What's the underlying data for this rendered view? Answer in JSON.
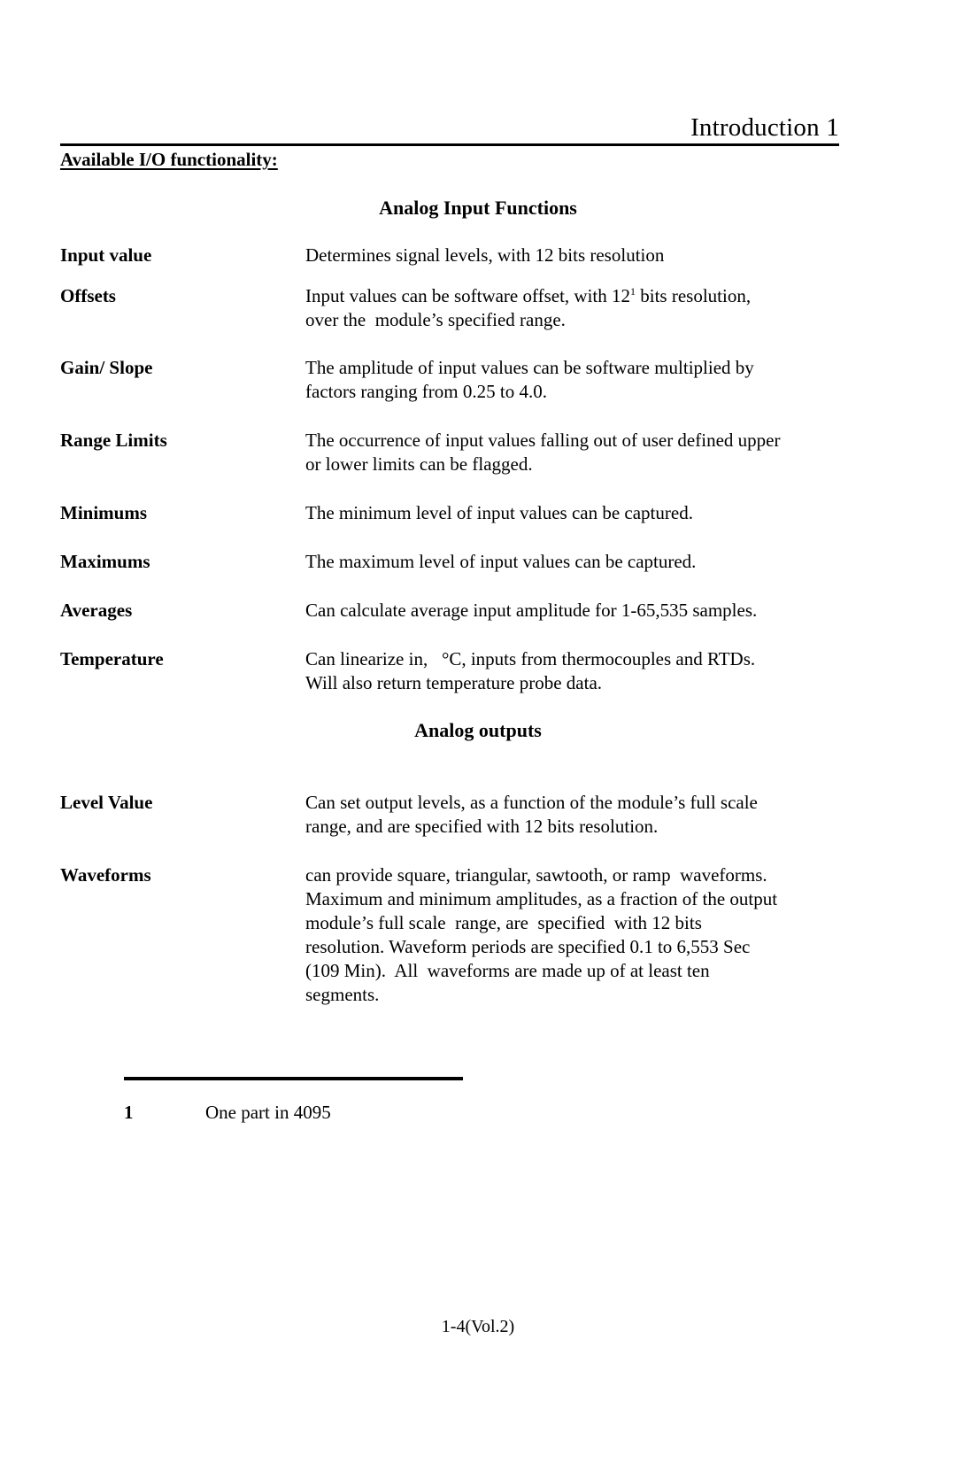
{
  "header": {
    "title": "Introduction 1"
  },
  "section": {
    "heading": "Available I/O functionality:"
  },
  "groups": {
    "analog_input_heading": "Analog Input Functions",
    "analog_output_heading": "Analog outputs"
  },
  "analog_input_rows": [
    {
      "term": "Input value",
      "lines": [
        "Determines signal levels, with 12 bits resolution"
      ]
    },
    {
      "term": "Offsets",
      "lines": [
        "Input values can be software offset, with 12",
        " bits resolution,",
        "over the  module’s specified range."
      ],
      "footnote_marker": "1"
    },
    {
      "term": "Gain/ Slope",
      "lines": [
        "The amplitude of input values can be software multiplied by",
        "factors ranging from 0.25 to 4.0."
      ]
    },
    {
      "term": "Range Limits",
      "lines": [
        "The occurrence of input values falling out of user defined upper",
        "or lower limits can be flagged."
      ]
    },
    {
      "term": "Minimums",
      "lines": [
        "The minimum level of input values can be captured."
      ]
    },
    {
      "term": "Maximums",
      "lines": [
        "The maximum level of input values can be captured."
      ]
    },
    {
      "term": "Averages",
      "lines": [
        "Can calculate average input amplitude for 1-65,535 samples."
      ]
    },
    {
      "term": "Temperature",
      "lines": [
        "Can linearize in,   °C, inputs from thermocouples and RTDs.",
        "Will also return temperature probe data."
      ]
    }
  ],
  "analog_output_rows": [
    {
      "term": "Level Value",
      "lines": [
        "Can set output levels, as a function of the module’s full scale",
        "range, and are specified with 12 bits resolution."
      ]
    },
    {
      "term": "Waveforms",
      "lines": [
        "can provide square, triangular, sawtooth, or ramp  waveforms.",
        "Maximum and minimum amplitudes, as a fraction of the output",
        "module’s full scale  range, are  specified  with 12 bits",
        "resolution. Waveform periods are specified 0.1 to 6,553 Sec",
        "(109 Min).  All  waveforms are made up of at least ten",
        "segments."
      ]
    }
  ],
  "rows_text": {
    "input_value_term": "Input value",
    "input_value_desc": "Determines signal levels, with 12 bits resolution",
    "offsets_term": "Offsets",
    "offsets_desc_a": "Input values can be software offset, with 12",
    "offsets_fn": "1",
    "offsets_desc_b": " bits resolution,",
    "offsets_desc_line2": "over the  module’s specified range.",
    "gain_term": "Gain/ Slope",
    "gain_desc_line1": "The amplitude of input values can be software multiplied by",
    "gain_desc_line2": "factors ranging from 0.25 to 4.0.",
    "range_term": "Range Limits",
    "range_desc_line1": "The occurrence of input values falling out of user defined upper",
    "range_desc_line2": "or lower limits can be flagged.",
    "min_term": "Minimums",
    "min_desc": "The minimum level of input values can be captured.",
    "max_term": "Maximums",
    "max_desc": "The maximum level of input values can be captured.",
    "avg_term": "Averages",
    "avg_desc": "Can calculate average input amplitude for 1-65,535 samples.",
    "temp_term": "Temperature",
    "temp_desc_line1": "Can linearize in,   °C, inputs from thermocouples and RTDs.",
    "temp_desc_line2": "Will also return temperature probe data.",
    "level_term": "Level Value",
    "level_desc_line1": "Can set output levels, as a function of the module’s full scale",
    "level_desc_line2": "range, and are specified with 12 bits resolution.",
    "wave_term": "Waveforms",
    "wave_desc_line1": "can provide square, triangular, sawtooth, or ramp  waveforms.",
    "wave_desc_line2": "Maximum and minimum amplitudes, as a fraction of the output",
    "wave_desc_line3": "module’s full scale  range, are  specified  with 12 bits",
    "wave_desc_line4": "resolution. Waveform periods are specified 0.1 to 6,553 Sec",
    "wave_desc_line5": "(109 Min).  All  waveforms are made up of at least ten",
    "wave_desc_line6": "segments."
  },
  "footnote": {
    "marker": "1",
    "text": "One part in 4095"
  },
  "page_footer": {
    "text": "1-4(Vol.2)"
  },
  "colors": {
    "text": "#000000",
    "background": "#ffffff",
    "rule": "#000000"
  }
}
